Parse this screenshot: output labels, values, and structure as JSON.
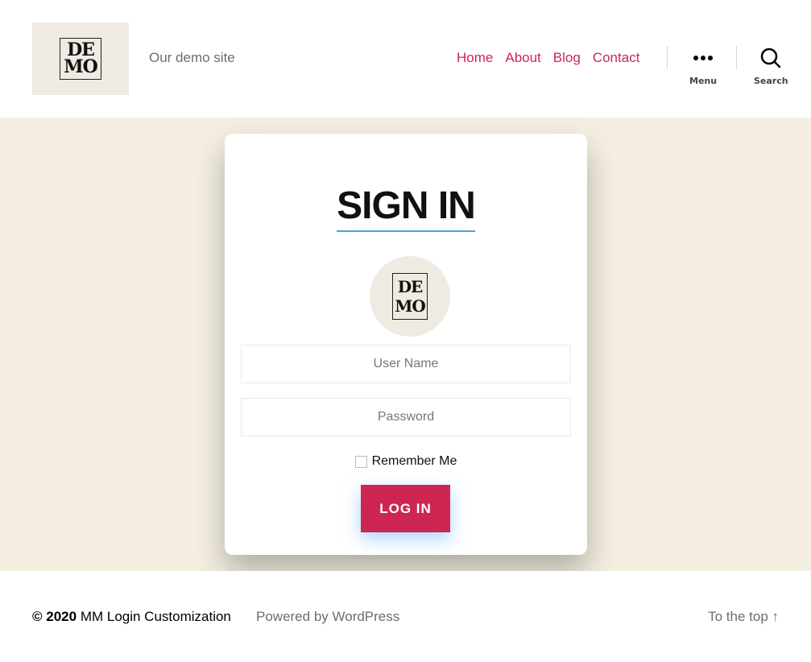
{
  "header": {
    "logo_line1": "DE",
    "logo_line2": "MO",
    "tagline": "Our demo site",
    "nav": [
      "Home",
      "About",
      "Blog",
      "Contact"
    ],
    "menu_label": "Menu",
    "search_label": "Search"
  },
  "login": {
    "title": "SIGN IN",
    "avatar_line1": "DE",
    "avatar_line2": "MO",
    "username_placeholder": "User Name",
    "password_placeholder": "Password",
    "remember_label": "Remember Me",
    "remember_checked": false,
    "button_label": "LOG IN"
  },
  "footer": {
    "year": "© 2020",
    "site_name": "MM Login Customization",
    "powered": "Powered by WordPress",
    "to_top": "To the top ↑"
  },
  "colors": {
    "accent": "#cd2653",
    "hero_bg": "#f4efe1",
    "logo_bg": "#efebe3",
    "underline": "#4aa3df"
  }
}
